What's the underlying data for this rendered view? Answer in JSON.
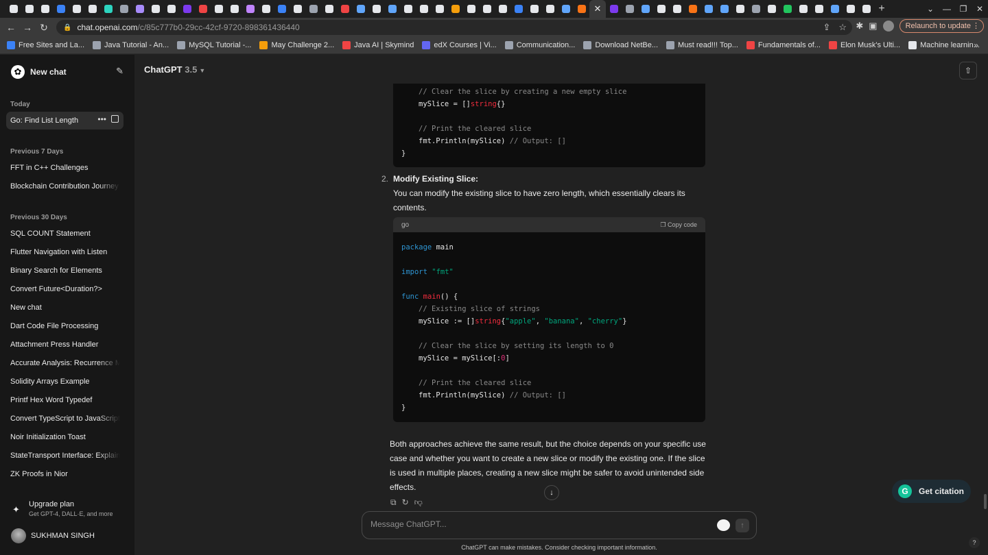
{
  "browser": {
    "url_host": "chat.openai.com",
    "url_path": "/c/85c777b0-29cc-42cf-9720-898361436440",
    "relaunch_label": "Relaunch to update",
    "bookmarks": [
      {
        "label": "Free Sites and La...",
        "color": "#3b82f6"
      },
      {
        "label": "Java Tutorial - An...",
        "color": "#9ca3af"
      },
      {
        "label": "MySQL Tutorial -...",
        "color": "#9ca3af"
      },
      {
        "label": "May Challenge 2...",
        "color": "#f59e0b"
      },
      {
        "label": "Java AI | Skymind",
        "color": "#ef4444"
      },
      {
        "label": "edX Courses | Vi...",
        "color": "#6366f1"
      },
      {
        "label": "Communication...",
        "color": "#9ca3af"
      },
      {
        "label": "Download NetBe...",
        "color": "#9ca3af"
      },
      {
        "label": "Must read!!! Top...",
        "color": "#9ca3af"
      },
      {
        "label": "Fundamentals of...",
        "color": "#ef4444"
      },
      {
        "label": "Elon Musk's Ulti...",
        "color": "#ef4444"
      },
      {
        "label": "Machine learnin...",
        "color": "#e5e7eb"
      }
    ],
    "tab_colors": [
      "#e5e7eb",
      "#e5e7eb",
      "#e5e7eb",
      "#3b82f6",
      "#e5e7eb",
      "#e5e7eb",
      "#2dd4bf",
      "#9ca3af",
      "#a78bfa",
      "#e5e7eb",
      "#e5e7eb",
      "#7c3aed",
      "#ef4444",
      "#e5e7eb",
      "#e5e7eb",
      "#c084fc",
      "#e5e7eb",
      "#3b82f6",
      "#e5e7eb",
      "#9ca3af",
      "#e5e7eb",
      "#ef4444",
      "#60a5fa",
      "#e5e7eb",
      "#60a5fa",
      "#e5e7eb",
      "#e5e7eb",
      "#e5e7eb",
      "#f59e0b",
      "#e5e7eb",
      "#e5e7eb",
      "#e5e7eb",
      "#3b82f6",
      "#e5e7eb",
      "#e5e7eb",
      "#60a5fa",
      "#f97316"
    ],
    "tab_colors_after": [
      "#7c3aed",
      "#9ca3af",
      "#60a5fa",
      "#e5e7eb",
      "#e5e7eb",
      "#f97316",
      "#60a5fa",
      "#60a5fa",
      "#e5e7eb",
      "#9ca3af",
      "#e5e7eb",
      "#22c55e",
      "#e5e7eb",
      "#e5e7eb",
      "#60a5fa",
      "#e5e7eb",
      "#e5e7eb"
    ]
  },
  "sidebar": {
    "new_chat": "New chat",
    "today_title": "Today",
    "active_chat": "Go: Find List Length",
    "prev7_title": "Previous 7 Days",
    "prev7": [
      "FFT in C++ Challenges",
      "Blockchain Contribution Journey"
    ],
    "prev30_title": "Previous 30 Days",
    "prev30": [
      "SQL COUNT Statement",
      "Flutter Navigation with Listen",
      "Binary Search for Elements",
      "Convert Future<Duration?>",
      "New chat",
      "Dart Code File Processing",
      "Attachment Press Handler",
      "Accurate Analysis: Recurrence Me",
      "Solidity Arrays Example",
      "Printf Hex Word Typedef",
      "Convert TypeScript to JavaScript",
      "Noir Initialization Toast",
      "StateTransport Interface: Explaine",
      "ZK Proofs in Nior"
    ],
    "upgrade_title": "Upgrade plan",
    "upgrade_sub": "Get GPT-4, DALL·E, and more",
    "user_name": "SUKHMAN SINGH"
  },
  "main": {
    "model_name": "ChatGPT",
    "model_version": "3.5",
    "code1": {
      "comment1": "// Clear the slice by creating a new empty slice",
      "line2_a": "mySlice = []",
      "line2_type": "string",
      "line2_b": "{}",
      "comment2": "// Print the cleared slice",
      "line4_a": "fmt.Println(mySlice) ",
      "line4_comment": "// Output: []",
      "close": "}"
    },
    "list_number": "2.",
    "list_title": "Modify Existing Slice:",
    "list_body": "You can modify the existing slice to have zero length, which essentially clears its contents.",
    "code2": {
      "lang": "go",
      "copy_label": "Copy code",
      "kw_package": "package",
      "pkg_name": " main",
      "kw_import": "import",
      "import_path": " \"fmt\"",
      "kw_func": "func",
      "fn_main": " main",
      "fn_sig": "() {",
      "comment_existing": "// Existing slice of strings",
      "decl_a": "mySlice := []",
      "decl_type": "string",
      "decl_open": "{",
      "s1": "\"apple\"",
      "comma1": ", ",
      "s2": "\"banana\"",
      "comma2": ", ",
      "s3": "\"cherry\"",
      "decl_close": "}",
      "comment_clear": "// Clear the slice by setting its length to 0",
      "reslice_a": "mySlice = mySlice[:",
      "reslice_num": "0",
      "reslice_b": "]",
      "comment_print": "// Print the cleared slice",
      "print_a": "fmt.Println(mySlice) ",
      "print_comment": "// Output: []",
      "close": "}"
    },
    "conclusion": "Both approaches achieve the same result, but the choice depends on your specific use case and whether you want to create a new slice or modify the existing one. If the slice is used in multiple places, creating a new slice might be safer to avoid unintended side effects.",
    "composer_placeholder": "Message ChatGPT...",
    "disclaimer": "ChatGPT can make mistakes. Consider checking important information.",
    "citation_label": "Get citation"
  }
}
